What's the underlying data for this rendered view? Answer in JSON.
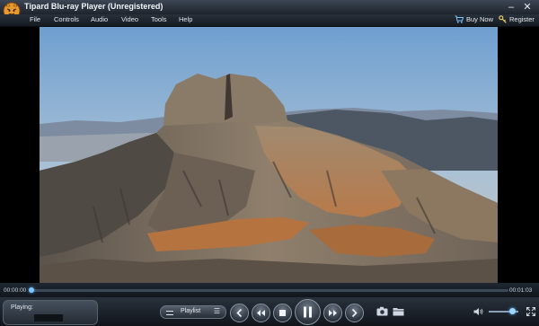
{
  "window": {
    "title": "Tipard Blu-ray Player (Unregistered)"
  },
  "title_buttons": {
    "minimize": "–",
    "close": "✕"
  },
  "menu": {
    "items": [
      "File",
      "Controls",
      "Audio",
      "Video",
      "Tools",
      "Help"
    ],
    "buy_now": "Buy Now",
    "register": "Register"
  },
  "playback": {
    "current_time": "00:00:00",
    "total_time": "00:01:03",
    "progress_fraction": 0.003,
    "volume_fraction": 0.8
  },
  "status": {
    "playing_label": "Playing:"
  },
  "playlist": {
    "label": "Playlist"
  },
  "colors": {
    "accent": "#4fb0ff",
    "bar_dark": "#11151a"
  },
  "icons": [
    "tiger-logo-icon",
    "cart-icon",
    "key-icon",
    "previous-chapter-icon",
    "rewind-icon",
    "stop-icon",
    "pause-icon",
    "fast-forward-icon",
    "next-chapter-icon",
    "snapshot-camera-icon",
    "open-folder-icon",
    "volume-speaker-icon",
    "fullscreen-icon"
  ]
}
